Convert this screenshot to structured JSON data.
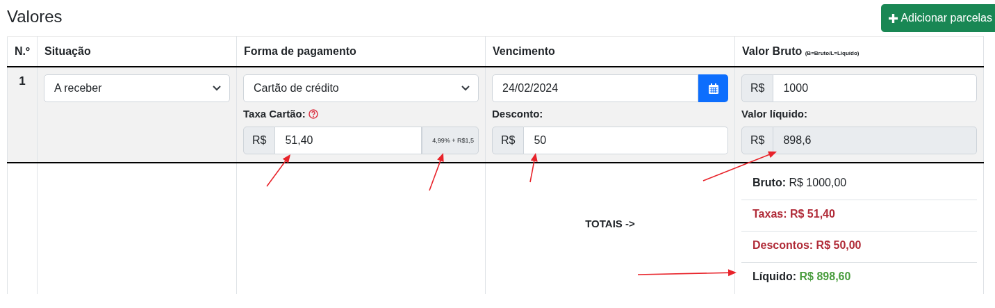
{
  "title": "Valores",
  "add_button": {
    "label": "Adicionar parcelas"
  },
  "table": {
    "columns": [
      {
        "label": "N.º"
      },
      {
        "label": "Situação"
      },
      {
        "label": "Forma de pagamento"
      },
      {
        "label": "Vencimento"
      },
      {
        "label": "Valor Bruto",
        "note": "(B=Bruto/L=Liquído)"
      }
    ],
    "rows": [
      {
        "number": "1",
        "status": {
          "value": "A receber"
        },
        "payment": {
          "value": "Cartão de crédito"
        },
        "fee": {
          "label": "Taxa Cartão:",
          "prefix": "R$",
          "value": "51,40",
          "suffix": "4,99% + R$1,5"
        },
        "due": {
          "value": "24/02/2024"
        },
        "discount": {
          "label": "Desconto:",
          "prefix": "R$",
          "value": "50"
        },
        "gross": {
          "prefix": "R$",
          "value": "1000"
        },
        "net": {
          "label": "Valor líquido:",
          "prefix": "R$",
          "value": "898,6",
          "disabled": true
        }
      }
    ]
  },
  "totals": {
    "label": "TOTAIS ->",
    "lines": [
      {
        "kind": "neutral",
        "label": "Bruto:",
        "value": "R$ 1000,00"
      },
      {
        "kind": "deduction",
        "label": "Taxas:",
        "value": "R$ 51,40"
      },
      {
        "kind": "deduction",
        "label": "Descontos:",
        "value": "R$ 50,00"
      },
      {
        "kind": "result",
        "label": "Líquido:",
        "value": "R$ 898,60"
      }
    ]
  }
}
